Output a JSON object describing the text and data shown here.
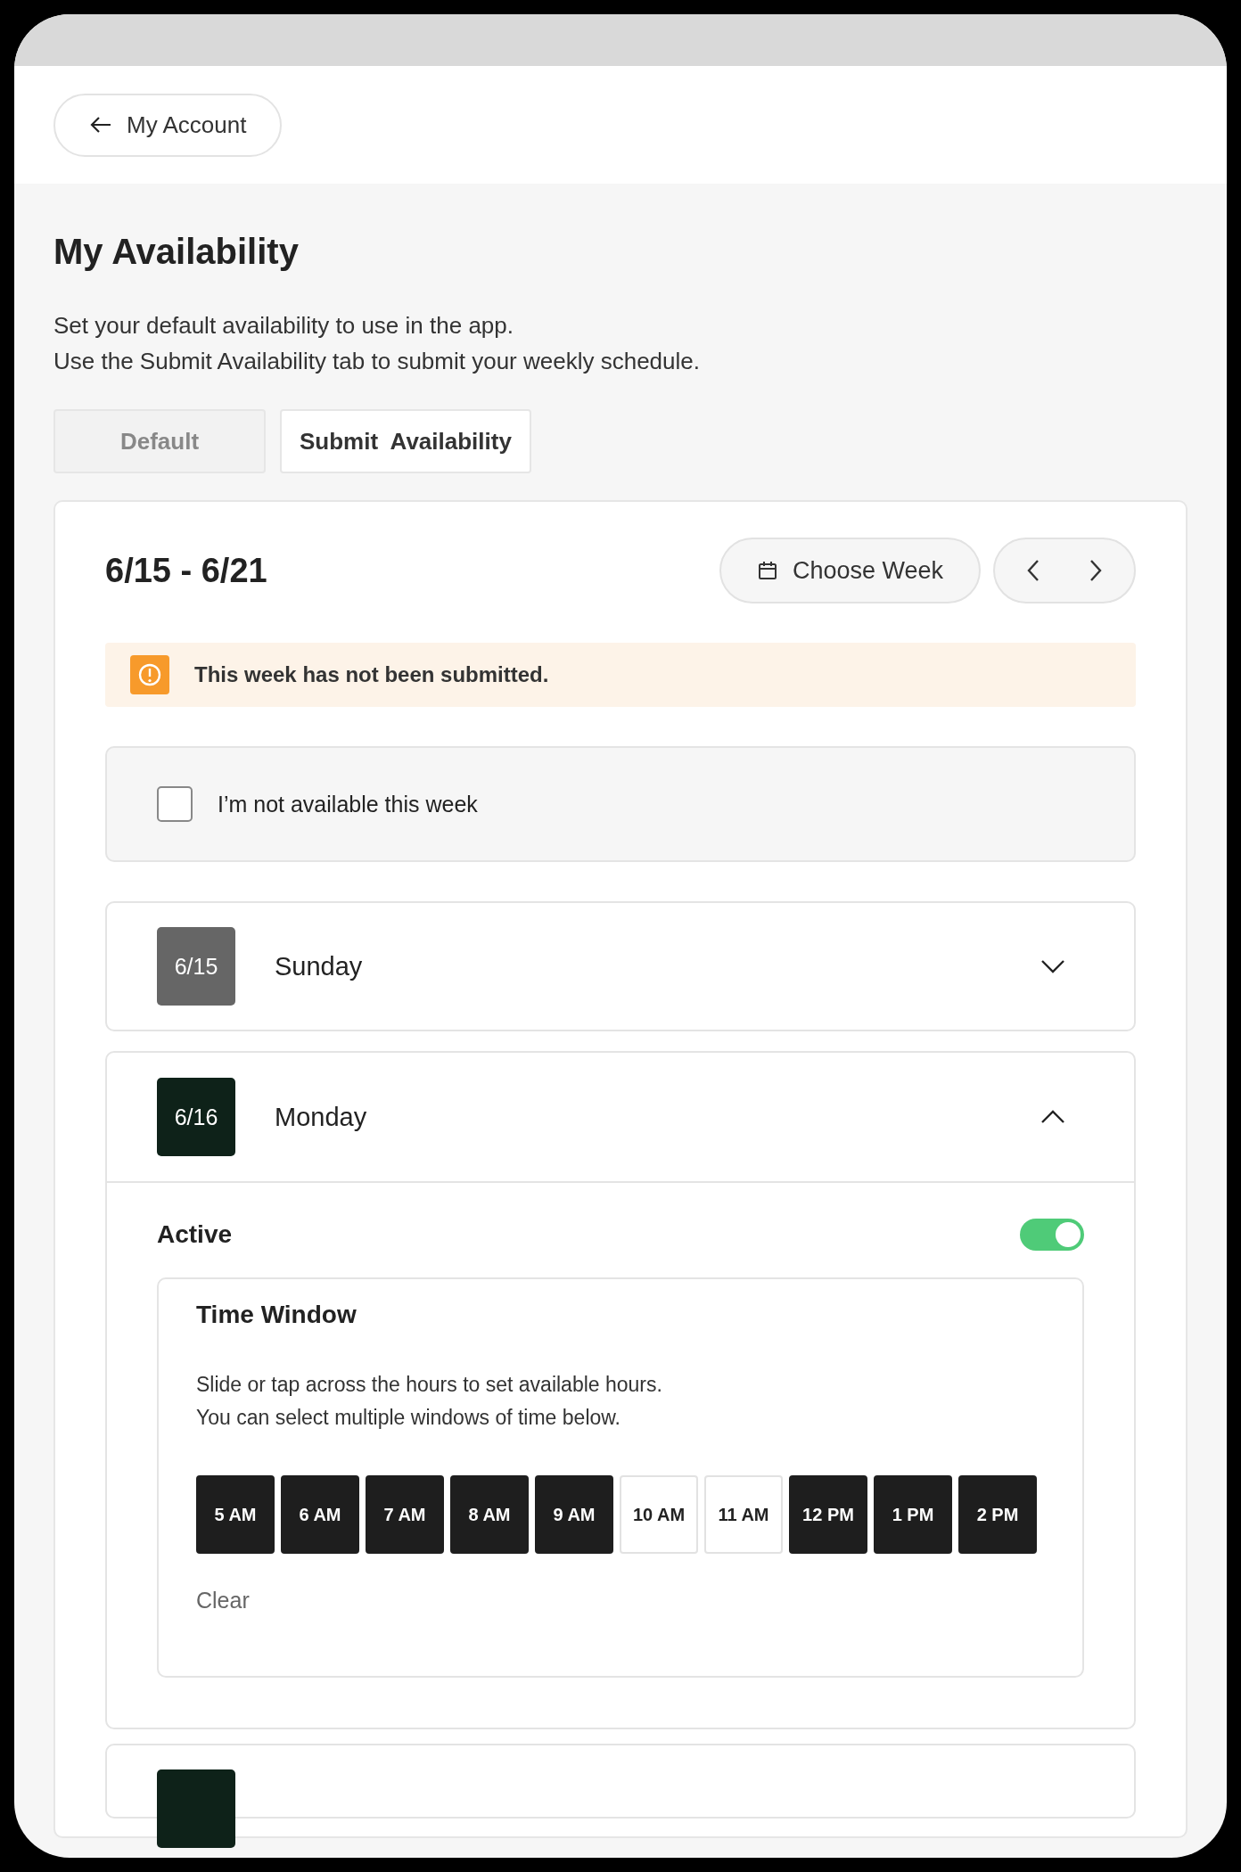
{
  "back_button": {
    "label": "My Account"
  },
  "page": {
    "title": "My Availability",
    "description_lines": [
      "Set your default availability to use in the app.",
      "Use the Submit Availability tab to submit your weekly schedule."
    ]
  },
  "tabs": [
    {
      "label": "Default",
      "selected": false
    },
    {
      "label": "Submit  Availability",
      "selected": true
    }
  ],
  "week": {
    "range": "6/15 - 6/21",
    "choose_button": "Choose Week"
  },
  "alert": {
    "message": "This week has not been submitted."
  },
  "unavailable": {
    "label": "I’m not available this week",
    "checked": false
  },
  "days": [
    {
      "date": "6/15",
      "name": "Sunday",
      "expanded": false,
      "active": false
    },
    {
      "date": "6/16",
      "name": "Monday",
      "expanded": true,
      "active": true,
      "active_label": "Active",
      "time_window": {
        "title": "Time Window",
        "hint_lines": [
          "Slide or tap across the hours to set available hours.",
          "You can select multiple windows of time below."
        ],
        "clear": "Clear",
        "hours": [
          {
            "label": "5 AM",
            "selected": true
          },
          {
            "label": "6 AM",
            "selected": true
          },
          {
            "label": "7 AM",
            "selected": true
          },
          {
            "label": "8 AM",
            "selected": true
          },
          {
            "label": "9 AM",
            "selected": true
          },
          {
            "label": "10 AM",
            "selected": false
          },
          {
            "label": "11 AM",
            "selected": false
          },
          {
            "label": "12 PM",
            "selected": true
          },
          {
            "label": "1 PM",
            "selected": true
          },
          {
            "label": "2 PM",
            "selected": true
          }
        ]
      }
    },
    {
      "kind": "partial",
      "active": true
    }
  ]
}
